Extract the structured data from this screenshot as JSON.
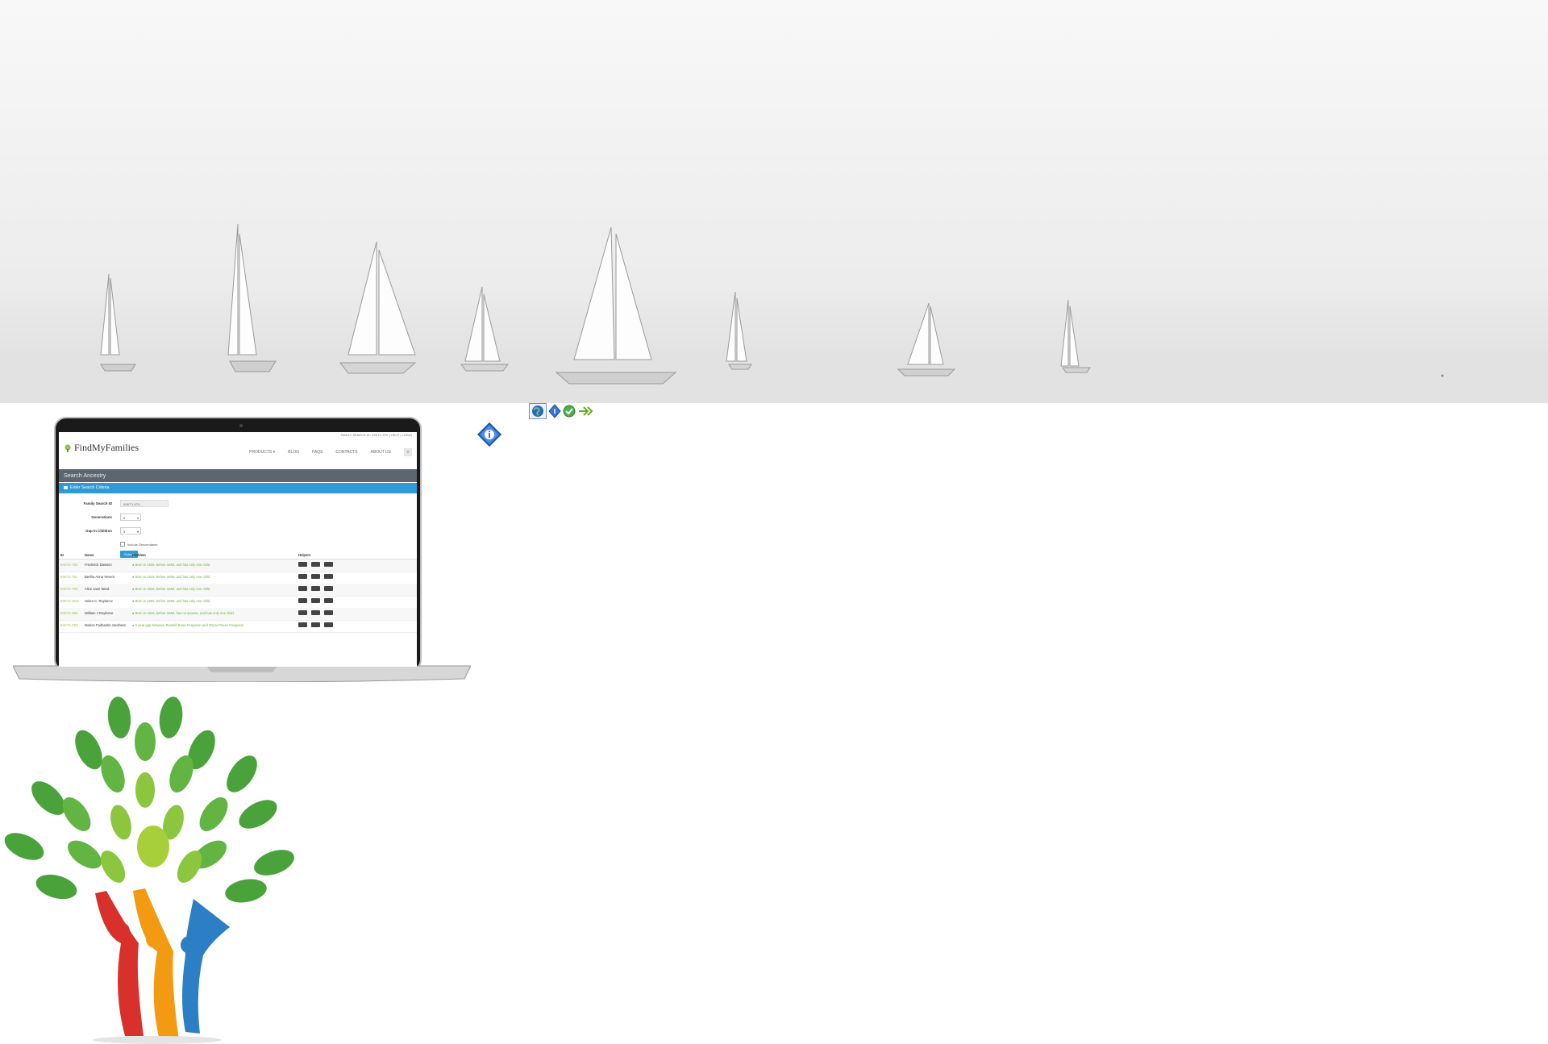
{
  "toolbar_icons": [
    "globe-icon",
    "info-small-icon",
    "check-circle-icon",
    "forward-arrow-icon"
  ],
  "info_icon": "info-icon",
  "laptop_app": {
    "brand": "FindMyFamilies",
    "topbar": "FAMILY SEARCH ID: 9XKT1-97V  |  HELP  |  LOGIN",
    "nav": [
      "PRODUCTS ▾",
      "BLOG",
      "FAQS",
      "CONTACTS",
      "ABOUT US"
    ],
    "page_title": "Search Ancestry",
    "section_title": "Enter Search Criteria",
    "form": {
      "family_id_label": "Family Search ID",
      "family_id_value": "9XKT1-97V",
      "generations_label": "Generations",
      "generations_value": "4",
      "gap_label": "Gap In Children",
      "gap_value": "3",
      "include_desc_label": "Include Descendants",
      "submit_label": "Submit"
    },
    "table": {
      "headers": [
        "ID",
        "Name",
        "Problem",
        "Helpers"
      ],
      "rows": [
        {
          "id": "9XKT1-752",
          "name": "Frederick Dawson",
          "problem": "● Born in 1819, before 1860, and has only one child"
        },
        {
          "id": "9XKT1-76L",
          "name": "Bertha Anna Vevers",
          "problem": "● Born in 1819, before 1860, and has only one child"
        },
        {
          "id": "9XKT1-7K5",
          "name": "Alice Jane Ward",
          "problem": "● Born in 1819, before 1860, and has only one child"
        },
        {
          "id": "9XKT1-3GH",
          "name": "Helen C. Roylance",
          "problem": "● Born in 1800, before 1860, and has only one child"
        },
        {
          "id": "9XKT1-866",
          "name": "William J Roylance",
          "problem": "● Born in 1816, before 1860, has no spouse, and has only one child"
        },
        {
          "id": "9XKT1-F92",
          "name": "Marion Fairbanks Jacobsen",
          "problem": "● 5 year gap between Russell Borer Ferguson and Oscar Priece Ferguson"
        }
      ]
    }
  },
  "colors": {
    "nav_blue": "#2f9ad8",
    "title_bar": "#5c6670",
    "link_green": "#8dc63f"
  }
}
